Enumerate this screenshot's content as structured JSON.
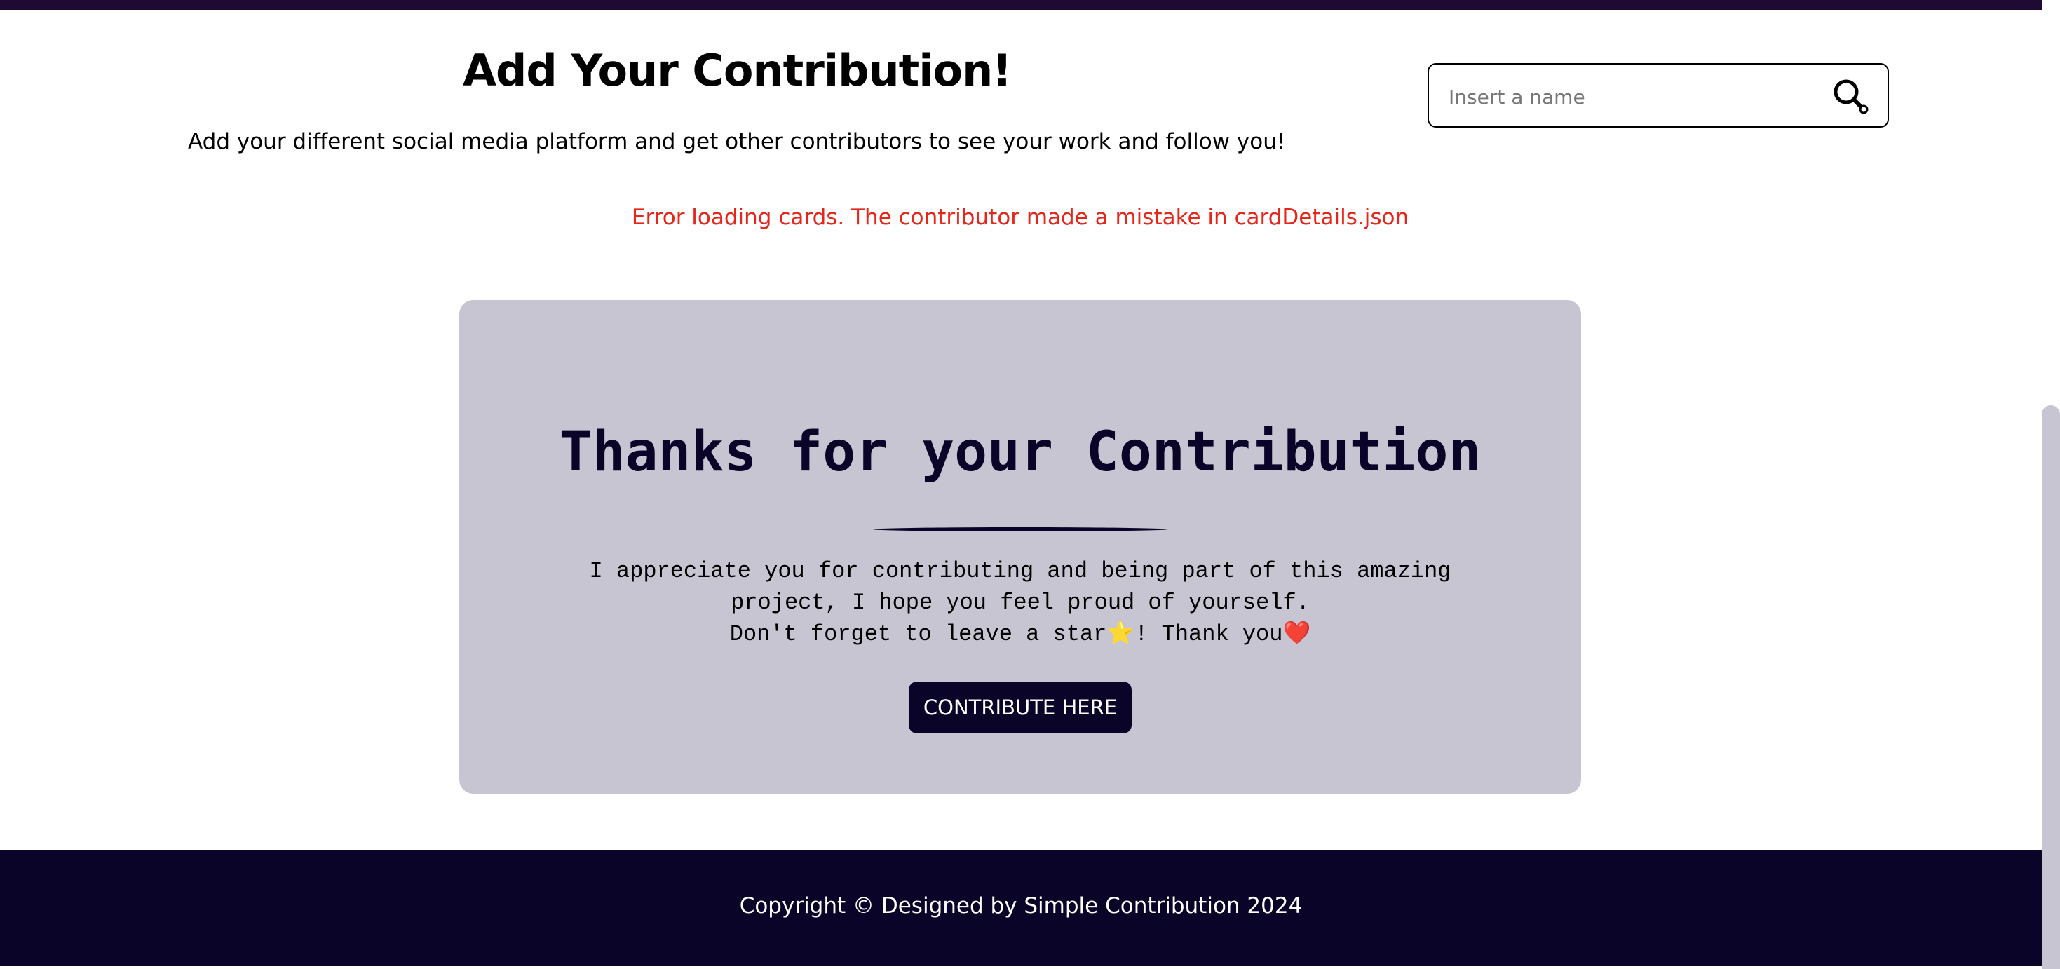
{
  "header": {
    "title": "Add Your Contribution!",
    "subtitle": "Add your different social media platform and get other contributors to see your work and follow you!"
  },
  "search": {
    "placeholder": "Insert a name",
    "value": "",
    "icon": "search-icon"
  },
  "error": {
    "message": "Error loading cards. The contributor made a mistake in cardDetails.json",
    "color": "#e5261b"
  },
  "thanks_card": {
    "title": "Thanks for your Contribution",
    "line1": "I appreciate you for contributing and being part of this amazing project, I hope you feel proud of yourself.",
    "line2": "Don't forget to leave a star⭐! Thank you❤️",
    "button_label": "CONTRIBUTE HERE"
  },
  "footer": {
    "text": "Copyright © Designed by Simple Contribution 2024"
  },
  "colors": {
    "brand_dark": "#0a0528",
    "top_bar": "#1e0a33",
    "card_bg": "#c7c5d1",
    "error": "#e5261b"
  }
}
